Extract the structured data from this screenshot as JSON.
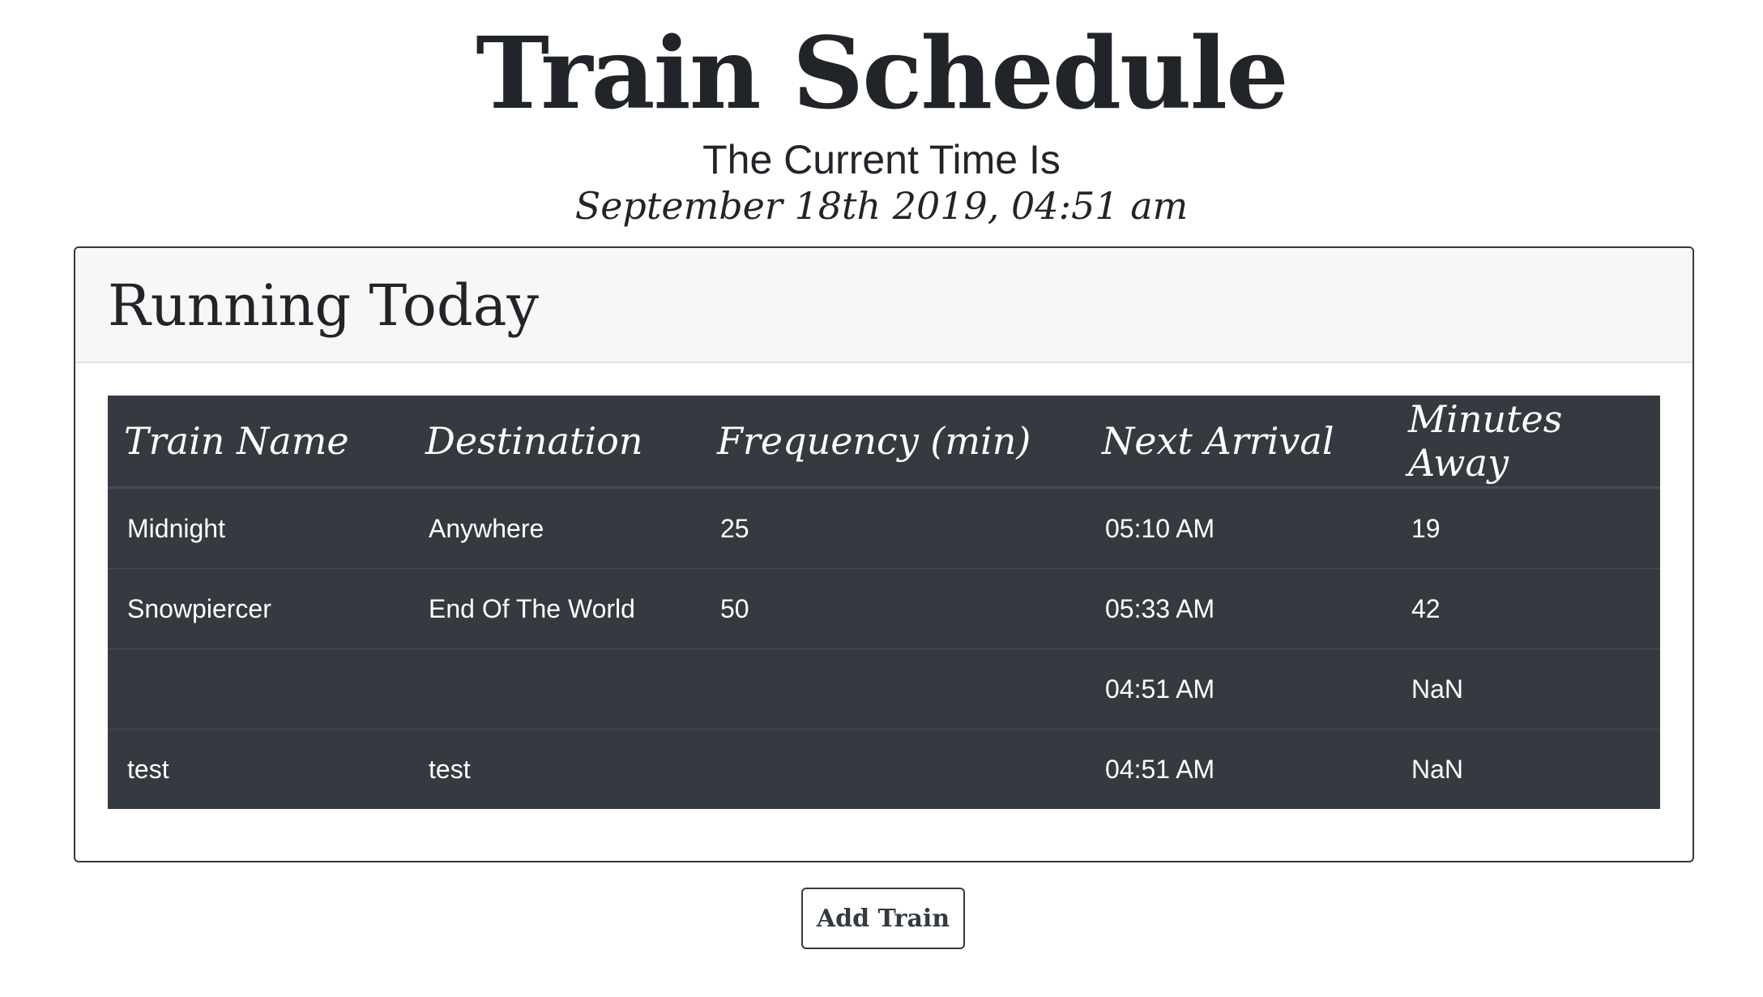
{
  "header": {
    "title": "Train Schedule",
    "subtitle": "The Current Time Is",
    "current_time": "September 18th 2019, 04:51 am"
  },
  "card": {
    "title": "Running Today"
  },
  "table": {
    "columns": [
      "Train Name",
      "Destination",
      "Frequency (min)",
      "Next Arrival",
      "Minutes Away"
    ],
    "rows": [
      {
        "train_name": "Midnight",
        "destination": "Anywhere",
        "frequency": "25",
        "next_arrival": "05:10 AM",
        "minutes_away": "19"
      },
      {
        "train_name": "Snowpiercer",
        "destination": "End Of The World",
        "frequency": "50",
        "next_arrival": "05:33 AM",
        "minutes_away": "42"
      },
      {
        "train_name": "",
        "destination": "",
        "frequency": "",
        "next_arrival": "04:51 AM",
        "minutes_away": "NaN"
      },
      {
        "train_name": "test",
        "destination": "test",
        "frequency": "",
        "next_arrival": "04:51 AM",
        "minutes_away": "NaN"
      }
    ]
  },
  "actions": {
    "add_train_label": "Add Train"
  },
  "colors": {
    "table_background": "#343a40",
    "card_header_background": "#f7f7f7",
    "text": "#212529"
  }
}
